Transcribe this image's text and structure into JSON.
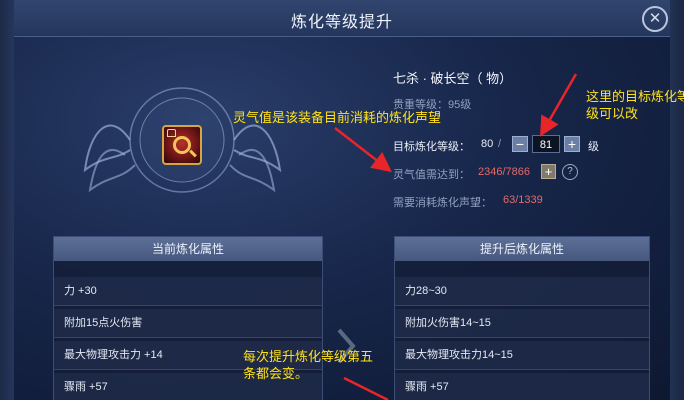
{
  "window": {
    "title": "炼化等级提升",
    "close_icon": "close-icon"
  },
  "item": {
    "name": "七杀 · 破长空（ 物）",
    "level_label": "贵重等级：95级",
    "icon": "equipment-icon"
  },
  "target_level": {
    "label": "目标炼化等级：",
    "current": "80",
    "separator": "/",
    "value": "81",
    "unit": "级",
    "minus": "−",
    "plus": "+"
  },
  "spirit": {
    "label": "灵气值需达到：",
    "value": "2346/7866",
    "add": "+",
    "help": "?"
  },
  "reputation": {
    "label": "需要消耗炼化声望：",
    "value": "63/1339"
  },
  "current_attrs": {
    "header": "当前炼化属性",
    "rows": [
      "力 +30",
      "附加15点火伤害",
      "最大物理攻击力 +14",
      "骤雨 +57"
    ]
  },
  "next_attrs": {
    "header": "提升后炼化属性",
    "rows": [
      "力28~30",
      "附加火伤害14~15",
      "最大物理攻击力14~15",
      "骤雨 +57"
    ]
  },
  "annotations": {
    "note1": "灵气值是该装备目前消耗的炼化声望",
    "note2_line1": "这里的目标炼化等",
    "note2_line2": "级可以改",
    "note3_line1": "每次提升炼化等级第五",
    "note3_line2": "条都会变。"
  },
  "colors": {
    "accent": "#ffe21a",
    "arrow": "#e8262a",
    "red_value": "#e26b6b",
    "gold": "#d8a640"
  }
}
